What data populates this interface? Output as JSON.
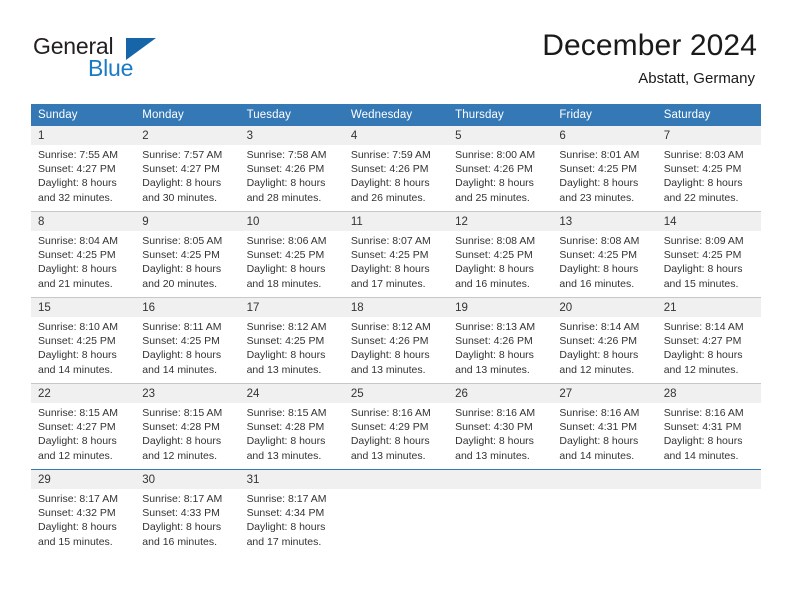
{
  "brand": {
    "name_top": "General",
    "name_bottom": "Blue"
  },
  "header": {
    "title": "December 2024",
    "location": "Abstatt, Germany"
  },
  "colors": {
    "header_band": "#3478b5",
    "daynum_band": "#f0f0f0",
    "brand_blue": "#1a7bc4",
    "text": "#333333"
  },
  "weekday_headers": [
    "Sunday",
    "Monday",
    "Tuesday",
    "Wednesday",
    "Thursday",
    "Friday",
    "Saturday"
  ],
  "weeks": [
    {
      "days": [
        {
          "num": "1",
          "sunrise": "Sunrise: 7:55 AM",
          "sunset": "Sunset: 4:27 PM",
          "daylight1": "Daylight: 8 hours",
          "daylight2": "and 32 minutes."
        },
        {
          "num": "2",
          "sunrise": "Sunrise: 7:57 AM",
          "sunset": "Sunset: 4:27 PM",
          "daylight1": "Daylight: 8 hours",
          "daylight2": "and 30 minutes."
        },
        {
          "num": "3",
          "sunrise": "Sunrise: 7:58 AM",
          "sunset": "Sunset: 4:26 PM",
          "daylight1": "Daylight: 8 hours",
          "daylight2": "and 28 minutes."
        },
        {
          "num": "4",
          "sunrise": "Sunrise: 7:59 AM",
          "sunset": "Sunset: 4:26 PM",
          "daylight1": "Daylight: 8 hours",
          "daylight2": "and 26 minutes."
        },
        {
          "num": "5",
          "sunrise": "Sunrise: 8:00 AM",
          "sunset": "Sunset: 4:26 PM",
          "daylight1": "Daylight: 8 hours",
          "daylight2": "and 25 minutes."
        },
        {
          "num": "6",
          "sunrise": "Sunrise: 8:01 AM",
          "sunset": "Sunset: 4:25 PM",
          "daylight1": "Daylight: 8 hours",
          "daylight2": "and 23 minutes."
        },
        {
          "num": "7",
          "sunrise": "Sunrise: 8:03 AM",
          "sunset": "Sunset: 4:25 PM",
          "daylight1": "Daylight: 8 hours",
          "daylight2": "and 22 minutes."
        }
      ]
    },
    {
      "days": [
        {
          "num": "8",
          "sunrise": "Sunrise: 8:04 AM",
          "sunset": "Sunset: 4:25 PM",
          "daylight1": "Daylight: 8 hours",
          "daylight2": "and 21 minutes."
        },
        {
          "num": "9",
          "sunrise": "Sunrise: 8:05 AM",
          "sunset": "Sunset: 4:25 PM",
          "daylight1": "Daylight: 8 hours",
          "daylight2": "and 20 minutes."
        },
        {
          "num": "10",
          "sunrise": "Sunrise: 8:06 AM",
          "sunset": "Sunset: 4:25 PM",
          "daylight1": "Daylight: 8 hours",
          "daylight2": "and 18 minutes."
        },
        {
          "num": "11",
          "sunrise": "Sunrise: 8:07 AM",
          "sunset": "Sunset: 4:25 PM",
          "daylight1": "Daylight: 8 hours",
          "daylight2": "and 17 minutes."
        },
        {
          "num": "12",
          "sunrise": "Sunrise: 8:08 AM",
          "sunset": "Sunset: 4:25 PM",
          "daylight1": "Daylight: 8 hours",
          "daylight2": "and 16 minutes."
        },
        {
          "num": "13",
          "sunrise": "Sunrise: 8:08 AM",
          "sunset": "Sunset: 4:25 PM",
          "daylight1": "Daylight: 8 hours",
          "daylight2": "and 16 minutes."
        },
        {
          "num": "14",
          "sunrise": "Sunrise: 8:09 AM",
          "sunset": "Sunset: 4:25 PM",
          "daylight1": "Daylight: 8 hours",
          "daylight2": "and 15 minutes."
        }
      ]
    },
    {
      "days": [
        {
          "num": "15",
          "sunrise": "Sunrise: 8:10 AM",
          "sunset": "Sunset: 4:25 PM",
          "daylight1": "Daylight: 8 hours",
          "daylight2": "and 14 minutes."
        },
        {
          "num": "16",
          "sunrise": "Sunrise: 8:11 AM",
          "sunset": "Sunset: 4:25 PM",
          "daylight1": "Daylight: 8 hours",
          "daylight2": "and 14 minutes."
        },
        {
          "num": "17",
          "sunrise": "Sunrise: 8:12 AM",
          "sunset": "Sunset: 4:25 PM",
          "daylight1": "Daylight: 8 hours",
          "daylight2": "and 13 minutes."
        },
        {
          "num": "18",
          "sunrise": "Sunrise: 8:12 AM",
          "sunset": "Sunset: 4:26 PM",
          "daylight1": "Daylight: 8 hours",
          "daylight2": "and 13 minutes."
        },
        {
          "num": "19",
          "sunrise": "Sunrise: 8:13 AM",
          "sunset": "Sunset: 4:26 PM",
          "daylight1": "Daylight: 8 hours",
          "daylight2": "and 13 minutes."
        },
        {
          "num": "20",
          "sunrise": "Sunrise: 8:14 AM",
          "sunset": "Sunset: 4:26 PM",
          "daylight1": "Daylight: 8 hours",
          "daylight2": "and 12 minutes."
        },
        {
          "num": "21",
          "sunrise": "Sunrise: 8:14 AM",
          "sunset": "Sunset: 4:27 PM",
          "daylight1": "Daylight: 8 hours",
          "daylight2": "and 12 minutes."
        }
      ]
    },
    {
      "days": [
        {
          "num": "22",
          "sunrise": "Sunrise: 8:15 AM",
          "sunset": "Sunset: 4:27 PM",
          "daylight1": "Daylight: 8 hours",
          "daylight2": "and 12 minutes."
        },
        {
          "num": "23",
          "sunrise": "Sunrise: 8:15 AM",
          "sunset": "Sunset: 4:28 PM",
          "daylight1": "Daylight: 8 hours",
          "daylight2": "and 12 minutes."
        },
        {
          "num": "24",
          "sunrise": "Sunrise: 8:15 AM",
          "sunset": "Sunset: 4:28 PM",
          "daylight1": "Daylight: 8 hours",
          "daylight2": "and 13 minutes."
        },
        {
          "num": "25",
          "sunrise": "Sunrise: 8:16 AM",
          "sunset": "Sunset: 4:29 PM",
          "daylight1": "Daylight: 8 hours",
          "daylight2": "and 13 minutes."
        },
        {
          "num": "26",
          "sunrise": "Sunrise: 8:16 AM",
          "sunset": "Sunset: 4:30 PM",
          "daylight1": "Daylight: 8 hours",
          "daylight2": "and 13 minutes."
        },
        {
          "num": "27",
          "sunrise": "Sunrise: 8:16 AM",
          "sunset": "Sunset: 4:31 PM",
          "daylight1": "Daylight: 8 hours",
          "daylight2": "and 14 minutes."
        },
        {
          "num": "28",
          "sunrise": "Sunrise: 8:16 AM",
          "sunset": "Sunset: 4:31 PM",
          "daylight1": "Daylight: 8 hours",
          "daylight2": "and 14 minutes."
        }
      ]
    },
    {
      "days": [
        {
          "num": "29",
          "sunrise": "Sunrise: 8:17 AM",
          "sunset": "Sunset: 4:32 PM",
          "daylight1": "Daylight: 8 hours",
          "daylight2": "and 15 minutes."
        },
        {
          "num": "30",
          "sunrise": "Sunrise: 8:17 AM",
          "sunset": "Sunset: 4:33 PM",
          "daylight1": "Daylight: 8 hours",
          "daylight2": "and 16 minutes."
        },
        {
          "num": "31",
          "sunrise": "Sunrise: 8:17 AM",
          "sunset": "Sunset: 4:34 PM",
          "daylight1": "Daylight: 8 hours",
          "daylight2": "and 17 minutes."
        },
        {
          "num": "",
          "sunrise": "",
          "sunset": "",
          "daylight1": "",
          "daylight2": ""
        },
        {
          "num": "",
          "sunrise": "",
          "sunset": "",
          "daylight1": "",
          "daylight2": ""
        },
        {
          "num": "",
          "sunrise": "",
          "sunset": "",
          "daylight1": "",
          "daylight2": ""
        },
        {
          "num": "",
          "sunrise": "",
          "sunset": "",
          "daylight1": "",
          "daylight2": ""
        }
      ]
    }
  ]
}
